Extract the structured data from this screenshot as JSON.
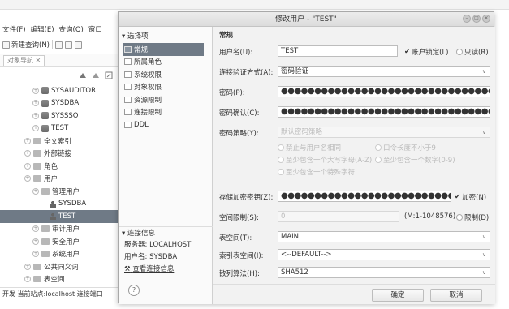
{
  "menu": [
    "文件(F)",
    "编辑(E)",
    "查询(Q)",
    "窗口"
  ],
  "toolbar": {
    "new_query": "新建查询(N)"
  },
  "navigator": {
    "tab_label": "对象导航"
  },
  "tree": [
    {
      "label": "SYSAUDITOR",
      "indent": 1,
      "icon": "user-icon"
    },
    {
      "label": "SYSDBA",
      "indent": 1,
      "icon": "user-icon"
    },
    {
      "label": "SYSSSO",
      "indent": 1,
      "icon": "user-icon"
    },
    {
      "label": "TEST",
      "indent": 1,
      "icon": "user-icon"
    },
    {
      "label": "全文索引",
      "indent": 0,
      "icon": "folder-icon"
    },
    {
      "label": "外部链接",
      "indent": 0,
      "icon": "folder-icon"
    },
    {
      "label": "角色",
      "indent": 0,
      "icon": "folder-icon"
    },
    {
      "label": "用户",
      "indent": 0,
      "icon": "folder-icon"
    },
    {
      "label": "管理用户",
      "indent": 1,
      "icon": "folder-icon"
    },
    {
      "label": "SYSDBA",
      "indent": 2,
      "icon": "person-icon"
    },
    {
      "label": "TEST",
      "indent": 2,
      "icon": "person-icon",
      "selected": true
    },
    {
      "label": "审计用户",
      "indent": 1,
      "icon": "folder-icon"
    },
    {
      "label": "安全用户",
      "indent": 1,
      "icon": "folder-icon"
    },
    {
      "label": "系统用户",
      "indent": 1,
      "icon": "folder-icon"
    },
    {
      "label": "公共同义词",
      "indent": 0,
      "icon": "folder-icon"
    },
    {
      "label": "表空间",
      "indent": 0,
      "icon": "folder-icon"
    }
  ],
  "statusbar": "开发 当前站点:localhost  连接端口",
  "dialog": {
    "title": "修改用户 - \"TEST\"",
    "options_head": "选择项",
    "options": [
      "常规",
      "所属角色",
      "系统权限",
      "对象权限",
      "资源限制",
      "连接限制",
      "DDL"
    ],
    "active_option": 0,
    "conn_head": "连接信息",
    "server": "服务器: LOCALHOST",
    "user": "用户名: SYSDBA",
    "view_conn": "查看连接信息",
    "help": "?",
    "section": "常规",
    "fields": {
      "username_label": "用户名(U):",
      "username_value": "TEST",
      "lock_label": "账户锁定(L)",
      "readonly_label": "只读(R)",
      "auth_label": "连接验证方式(A):",
      "auth_value": "密码验证",
      "pwd_label": "密码(P):",
      "pwd_value": "●●●●●●●●●●●●●●●●●●●●●●●●●●●●●●●●●●●●●●●●●●●",
      "pwd2_label": "密码确认(C):",
      "pwd2_value": "●●●●●●●●●●●●●●●●●●●●●●●●●●●●●●●●●●●●●●●●●●●",
      "policy_label": "密码策略(Y):",
      "policy_value": "默认密码策略",
      "policy_opt1": "禁止与用户名相同",
      "policy_opt2": "口令长度不小于9",
      "policy_opt3": "至少包含一个大写字母(A-Z)",
      "policy_opt4": "至少包含一个数字(0-9)",
      "policy_opt5": "至少包含一个特殊字符",
      "store_label": "存储加密密钥(Z):",
      "store_value": "●●●●●●●●●●●●●●●●●●●●●●●●●●●●●●●●●●●●●●●",
      "encrypt_label": "加密(N)",
      "space_label": "空间限制(S):",
      "space_value": "0",
      "space_range": "(M:1-1048576)",
      "limit_label": "限制(D)",
      "tablespace_label": "表空间(T):",
      "tablespace_value": "MAIN",
      "index_label": "索引表空间(I):",
      "index_value": "<--DEFAULT-->",
      "hash_label": "散列算法(H):",
      "hash_value": "SHA512"
    },
    "ok": "确定",
    "cancel": "取消"
  }
}
